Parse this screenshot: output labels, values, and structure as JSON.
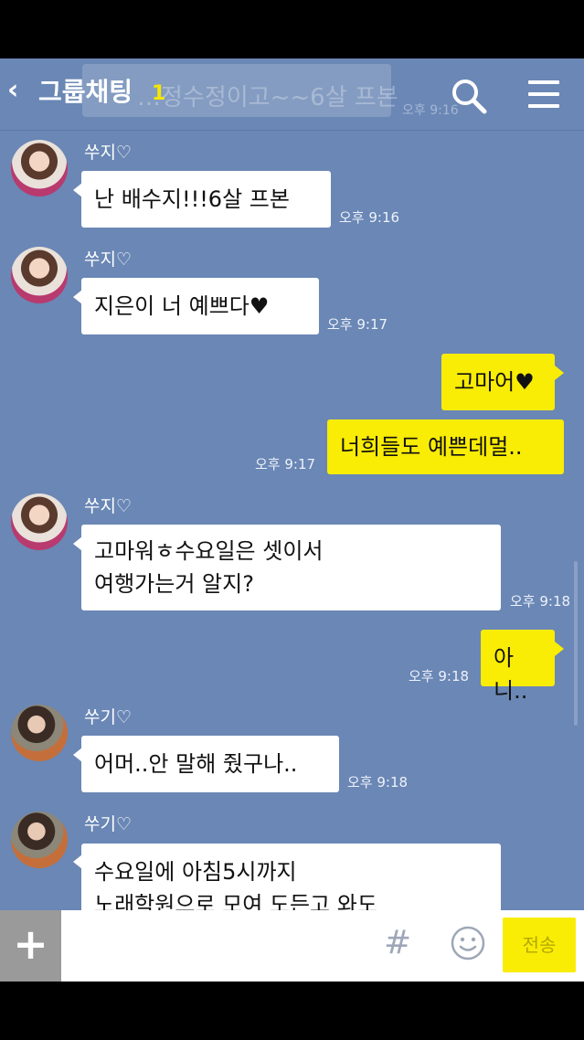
{
  "header": {
    "back_label": "‹",
    "title": "그룹채팅",
    "member_count": "1",
    "ghost_preview": "…정수정이고~~6살 프본",
    "ghost_time": "오후 9:16"
  },
  "messages": [
    {
      "sender": "쑤지♡",
      "text": [
        "난 배수지!!!6살 프본"
      ],
      "time": "오후 9:16"
    },
    {
      "sender": "쑤지♡",
      "text": [
        "지은이 너 예쁘다♥"
      ],
      "time": "오후 9:17"
    },
    {
      "text": [
        "고마어♥"
      ]
    },
    {
      "text": [
        "너희들도 예쁜데멀.."
      ],
      "time": "오후 9:17"
    },
    {
      "sender": "쑤지♡",
      "text": [
        "고마워ㅎ수요일은 셋이서",
        "여행가는거 알지?"
      ],
      "time": "오후 9:18"
    },
    {
      "text": [
        "아니.."
      ],
      "time": "오후 9:18"
    },
    {
      "sender": "쑤기♡",
      "text": [
        "어머..안 말해 줬구나.."
      ],
      "time": "오후 9:18"
    },
    {
      "sender": "쑤기♡",
      "text": [
        "수요일에 아침5시까지",
        "노래학원으로 모여 도든고 와도"
      ]
    }
  ],
  "input": {
    "plus_label": "+",
    "placeholder": "",
    "hash_label": "#",
    "send_label": "전송"
  },
  "colors": {
    "chat_background": "#6a87b5",
    "own_bubble": "#f9ec05",
    "other_bubble": "#ffffff",
    "count_accent": "#f7e600"
  },
  "icons": [
    "back-icon",
    "search-icon",
    "menu-icon",
    "plus-icon",
    "hash-icon",
    "emoji-icon"
  ]
}
